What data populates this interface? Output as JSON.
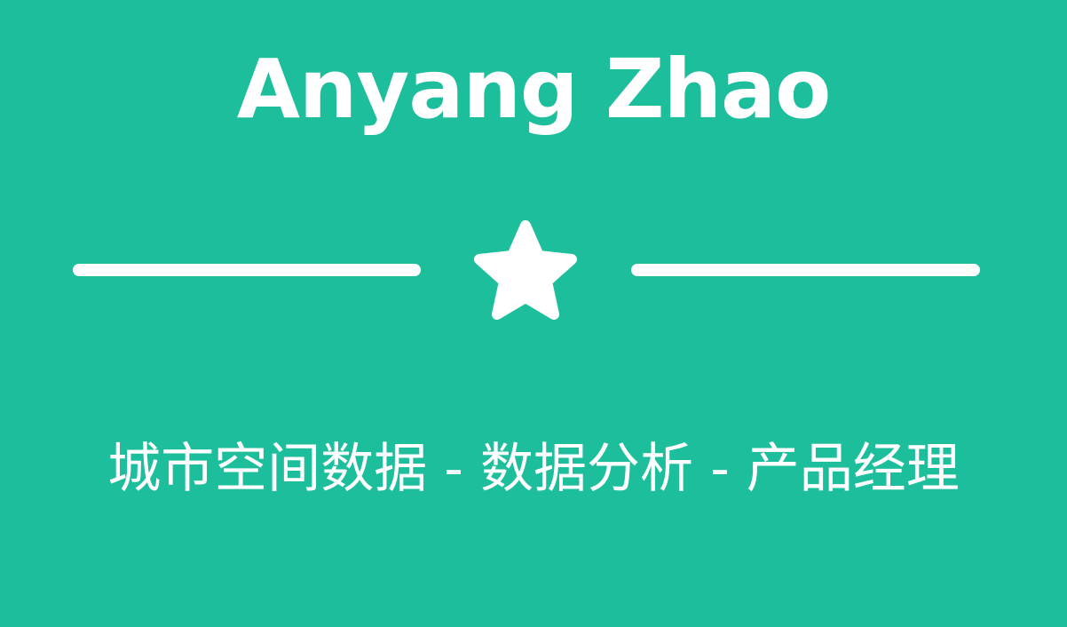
{
  "header": {
    "name": "Anyang Zhao",
    "tagline": "城市空间数据 - 数据分析 - 产品经理"
  },
  "divider": {
    "icon": "star-icon"
  },
  "colors": {
    "background": "#1dbe9c",
    "foreground": "#ffffff"
  }
}
